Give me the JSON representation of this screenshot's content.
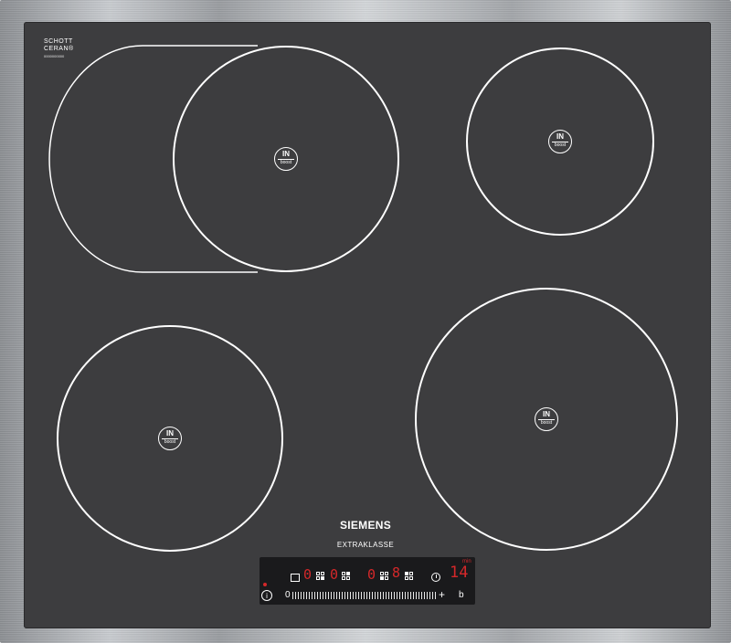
{
  "logo": {
    "line1": "SCHOTT",
    "line2": "CERAN®",
    "model": "0000000000"
  },
  "zones": {
    "badge_in": "IN",
    "badge_boost": "boost"
  },
  "brand": {
    "name": "SIEMENS",
    "line": "EXTRAKLASSE"
  },
  "controls": {
    "display_1": "0",
    "display_2": "0",
    "display_3": "0",
    "display_4": "8",
    "timer_value": "14",
    "timer_unit": "min",
    "power_label": "i",
    "slider_min": "0",
    "slider_plus": "+",
    "boost_key": "b"
  },
  "colors": {
    "glass": "#3d3d3f",
    "led_red": "#d4282a",
    "lines": "#ffffff"
  }
}
